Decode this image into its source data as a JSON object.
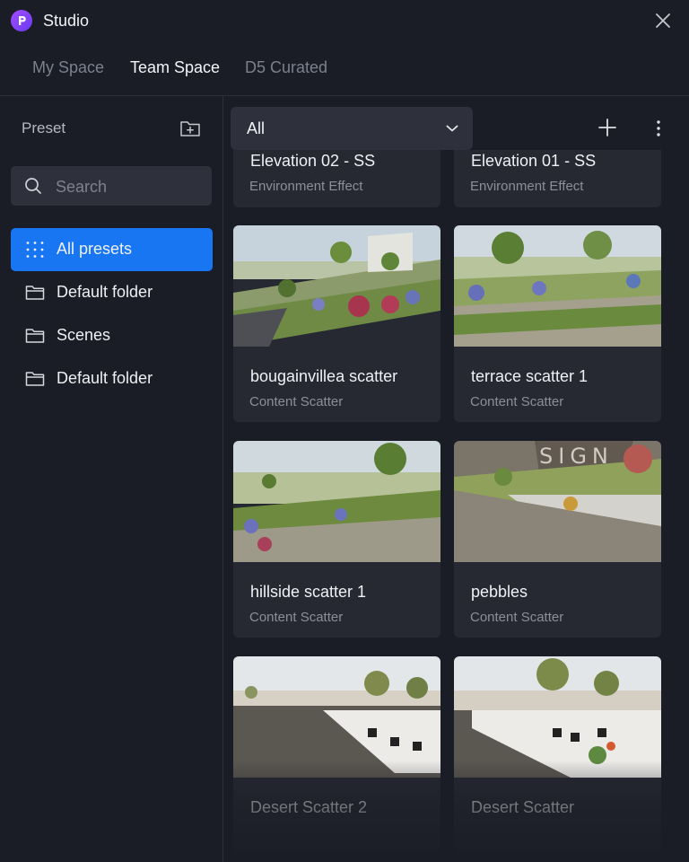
{
  "app": {
    "title": "Studio"
  },
  "tabs": [
    {
      "label": "My Space",
      "active": false
    },
    {
      "label": "Team Space",
      "active": true
    },
    {
      "label": "D5 Curated",
      "active": false
    }
  ],
  "sidebar": {
    "title": "Preset",
    "search_placeholder": "Search",
    "items": [
      {
        "label": "All presets",
        "icon": "grid-dots-icon",
        "active": true
      },
      {
        "label": "Default folder",
        "icon": "folder-icon",
        "active": false
      },
      {
        "label": "Scenes",
        "icon": "folder-icon",
        "active": false
      },
      {
        "label": "Default folder",
        "icon": "folder-icon",
        "active": false
      }
    ]
  },
  "filter": {
    "selected": "All"
  },
  "cards": [
    {
      "name": "Elevation 02 - SS",
      "category": "Environment Effect"
    },
    {
      "name": "Elevation 01 - SS",
      "category": "Environment Effect"
    },
    {
      "name": "bougainvillea scatter",
      "category": "Content Scatter"
    },
    {
      "name": "terrace scatter 1",
      "category": "Content Scatter"
    },
    {
      "name": "hillside scatter 1",
      "category": "Content Scatter"
    },
    {
      "name": "pebbles",
      "category": "Content Scatter"
    },
    {
      "name": "Desert Scatter 2",
      "category": ""
    },
    {
      "name": "Desert Scatter",
      "category": ""
    }
  ],
  "colors": {
    "accent": "#1876f2",
    "background": "#1b1d26",
    "card": "#262832",
    "logo": "#8b45ff"
  }
}
